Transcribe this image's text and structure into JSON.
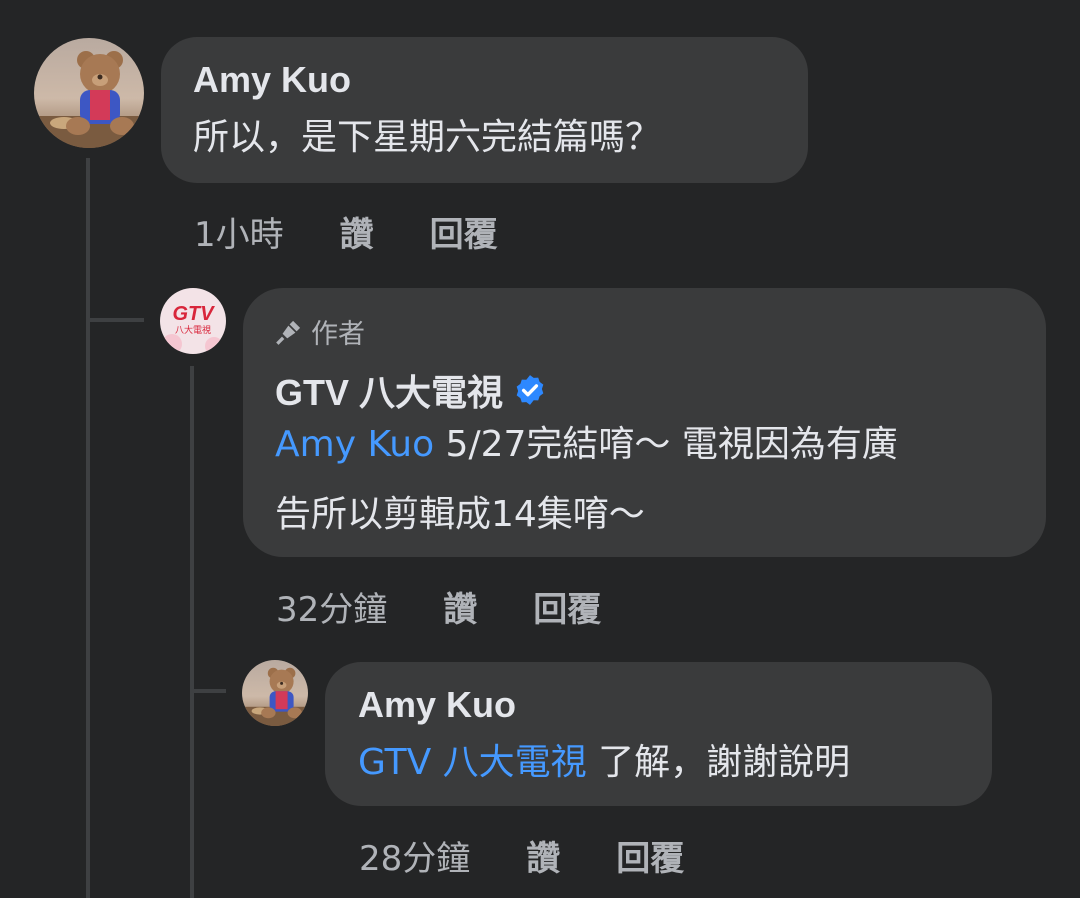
{
  "comments": [
    {
      "author": "Amy Kuo",
      "text": "所以，是下星期六完結篇嗎？",
      "time": "1小時",
      "like": "讚",
      "reply": "回覆"
    },
    {
      "badge": "作者",
      "author": "GTV 八大電視",
      "verified_icon": "verified-badge-icon",
      "mention": "Amy Kuo",
      "text_line1": " 5/27完結唷～ 電視因為有廣",
      "text_line2": "告所以剪輯成14集唷～",
      "time": "32分鐘",
      "like": "讚",
      "reply": "回覆"
    },
    {
      "author": "Amy Kuo",
      "mention": "GTV 八大電視",
      "text": " 了解，謝謝說明",
      "time": "28分鐘",
      "like": "讚",
      "reply": "回覆"
    }
  ],
  "avatar_logo_text": "GTV",
  "avatar_logo_subtext": "八大電視",
  "colors": {
    "background": "#242526",
    "bubble": "#3a3b3c",
    "mention": "#4599ff",
    "verified": "#2d88ff",
    "meta": "#b0b3b8"
  }
}
